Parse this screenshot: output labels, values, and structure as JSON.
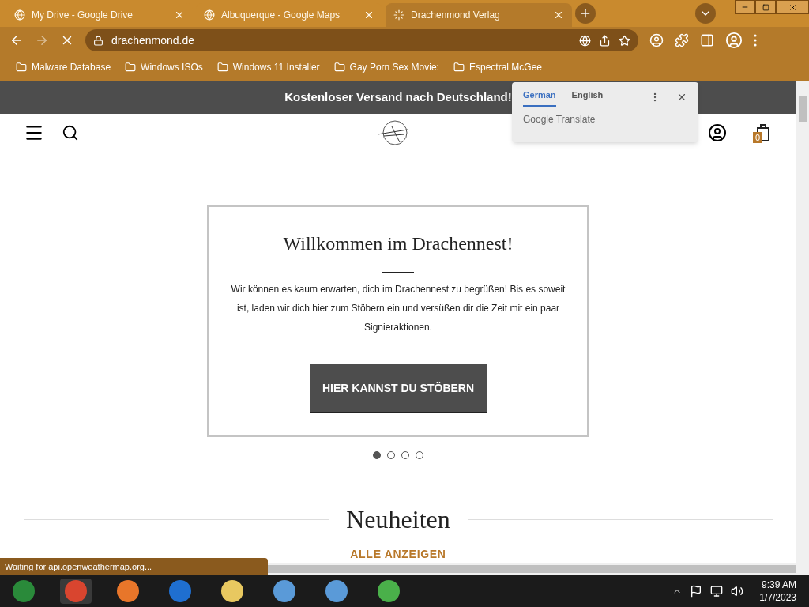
{
  "tabs": [
    {
      "title": "My Drive - Google Drive",
      "selected": false,
      "loading": false
    },
    {
      "title": "Albuquerque - Google Maps",
      "selected": false,
      "loading": false
    },
    {
      "title": "Drachenmond Verlag",
      "selected": true,
      "loading": true
    }
  ],
  "address": {
    "url": "drachenmond.de"
  },
  "bookmarks": [
    "Malware Database",
    "Windows ISOs",
    "Windows 11 Installer",
    "Gay Porn Sex Movie:",
    "Espectral McGee"
  ],
  "translate_popup": {
    "languages": [
      {
        "label": "German",
        "selected": true
      },
      {
        "label": "English",
        "selected": false
      }
    ],
    "brand": "Google Translate"
  },
  "banner": "Kostenloser Versand nach Deutschland!",
  "cart_count": "0",
  "hero": {
    "title": "Willkommen im Drachennest!",
    "text": "Wir können es kaum erwarten, dich im Drachennest zu begrüßen! Bis es soweit ist, laden wir dich hier zum Stöbern ein und versüßen dir die Zeit mit ein paar Signieraktionen.",
    "button": "HIER KANNST DU STÖBERN"
  },
  "slides": [
    {
      "selected": true
    },
    {
      "selected": false
    },
    {
      "selected": false
    },
    {
      "selected": false
    }
  ],
  "section": {
    "title": "Neuheiten",
    "link": "ALLE ANZEIGEN"
  },
  "status": "Waiting for api.openweathermap.org...",
  "clock": {
    "time": "9:39 AM",
    "date": "1/7/2023"
  }
}
